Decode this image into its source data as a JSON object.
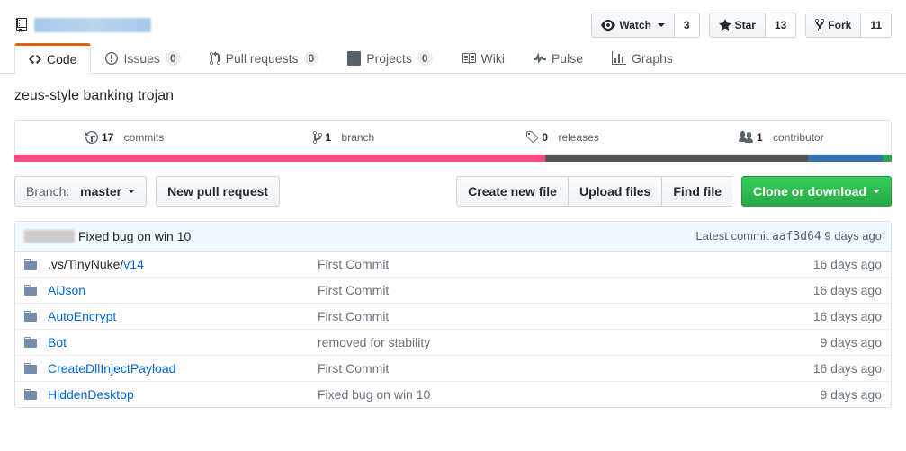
{
  "header": {
    "watch_label": "Watch",
    "watch_count": "3",
    "star_label": "Star",
    "star_count": "13",
    "fork_label": "Fork",
    "fork_count": "11"
  },
  "tabs": {
    "code": "Code",
    "issues": "Issues",
    "issues_count": "0",
    "pulls": "Pull requests",
    "pulls_count": "0",
    "projects": "Projects",
    "projects_count": "0",
    "wiki": "Wiki",
    "pulse": "Pulse",
    "graphs": "Graphs"
  },
  "description": "zeus-style banking trojan",
  "stats": {
    "commits_num": "17",
    "commits_label": "commits",
    "branch_num": "1",
    "branch_label": "branch",
    "releases_num": "0",
    "releases_label": "releases",
    "contributors_num": "1",
    "contributors_label": "contributor"
  },
  "lang": {
    "cpp": "60.5%",
    "c": "30%",
    "other": "8.5%",
    "last": "1%"
  },
  "toolbar": {
    "branch_prefix": "Branch:",
    "branch_name": "master",
    "new_pr": "New pull request",
    "create_file": "Create new file",
    "upload": "Upload files",
    "find": "Find file",
    "clone": "Clone or download"
  },
  "commit": {
    "message": "Fixed bug on win 10",
    "latest_prefix": "Latest commit",
    "sha": "aaf3d64",
    "age": "9 days ago"
  },
  "files": [
    {
      "type": "dir",
      "name_html": ".vs/TinyNuke/<span class='v14'>v14</span>",
      "path_prefix": ".vs/TinyNuke/",
      "path_leaf": "v14",
      "msg": "First Commit",
      "age": "16 days ago"
    },
    {
      "type": "dir",
      "name": "AiJson",
      "msg": "First Commit",
      "age": "16 days ago"
    },
    {
      "type": "dir",
      "name": "AutoEncrypt",
      "msg": "First Commit",
      "age": "16 days ago"
    },
    {
      "type": "dir",
      "name": "Bot",
      "msg": "removed for stability",
      "age": "9 days ago"
    },
    {
      "type": "dir",
      "name": "CreateDllInjectPayload",
      "msg": "First Commit",
      "age": "16 days ago"
    },
    {
      "type": "dir",
      "name": "HiddenDesktop",
      "msg": "Fixed bug on win 10",
      "age": "9 days ago"
    }
  ]
}
